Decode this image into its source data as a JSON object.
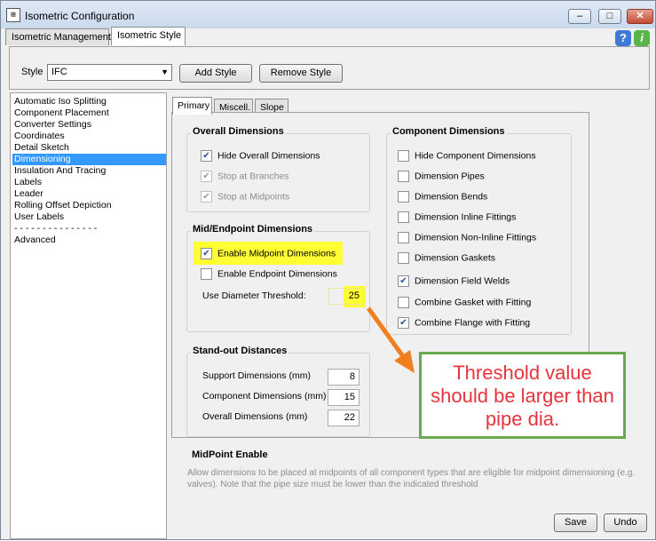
{
  "window": {
    "title": "Isometric Configuration",
    "app_icon": "app-logo-icon",
    "controls": [
      "minimize-icon",
      "maximize-icon",
      "close-icon"
    ]
  },
  "main_tabs": [
    {
      "label": "Isometric Management",
      "active": false
    },
    {
      "label": "Isometric Style",
      "active": true
    }
  ],
  "style_bar": {
    "label": "Style",
    "selected": "IFC",
    "add_label": "Add Style",
    "remove_label": "Remove Style"
  },
  "sidebar": {
    "items": [
      "Automatic Iso Splitting",
      "Component Placement",
      "Converter Settings",
      "Coordinates",
      "Detail Sketch",
      "Dimensioning",
      "Insulation And Tracing",
      "Labels",
      "Leader",
      "Rolling Offset Depiction",
      "User Labels",
      "- - - - - - - - - - - - - - -",
      "Advanced"
    ],
    "selected": "Dimensioning"
  },
  "inner_tabs": [
    "Primary",
    "Miscell.",
    "Slope"
  ],
  "overall_dimensions": {
    "title": "Overall Dimensions",
    "hide": {
      "label": "Hide Overall Dimensions",
      "checked": true
    },
    "branches": {
      "label": "Stop at Branches",
      "checked": true,
      "disabled": true
    },
    "midpoints": {
      "label": "Stop at Midpoints",
      "checked": true,
      "disabled": true
    }
  },
  "mid_endpoint": {
    "title": "Mid/Endpoint Dimensions",
    "enable_mid": {
      "label": "Enable Midpoint Dimensions",
      "checked": true
    },
    "enable_end": {
      "label": "Enable Endpoint Dimensions",
      "checked": false
    },
    "threshold_label": "Use Diameter Threshold:",
    "threshold_value": "25"
  },
  "standout": {
    "title": "Stand-out Distances",
    "support_label": "Support Dimensions (mm)",
    "support_value": "8",
    "component_label": "Component Dimensions (mm)",
    "component_value": "15",
    "overall_label": "Overall Dimensions (mm)",
    "overall_value": "22"
  },
  "component_dimensions": {
    "title": "Component Dimensions",
    "items": [
      {
        "label": "Hide Component Dimensions",
        "checked": false
      },
      {
        "label": "Dimension Pipes",
        "checked": false
      },
      {
        "label": "Dimension Bends",
        "checked": false
      },
      {
        "label": "Dimension Inline Fittings",
        "checked": false
      },
      {
        "label": "Dimension Non-Inline Fittings",
        "checked": false
      },
      {
        "label": "Dimension Gaskets",
        "checked": false
      },
      {
        "label": "Dimension Field Welds",
        "checked": true
      },
      {
        "label": "Combine Gasket with Fitting",
        "checked": false
      },
      {
        "label": "Combine Flange with Fitting",
        "checked": true
      }
    ]
  },
  "description": {
    "title": "MidPoint Enable",
    "text": "Allow dimensions to be placed at midpoints of all component types that are eligible for midpoint dimensioning (e.g. valves). Note that the pipe size must be lower than the indicated threshold"
  },
  "footer": {
    "save_label": "Save",
    "undo_label": "Undo"
  },
  "annotation": {
    "text": "Threshold value should be larger than pipe dia.",
    "text_color": "#e8343c",
    "border_color": "#6aa84f",
    "arrow_color": "#f07f1f",
    "highlight_color": "#ffff33"
  },
  "colors": {
    "selection": "#3399ff"
  }
}
